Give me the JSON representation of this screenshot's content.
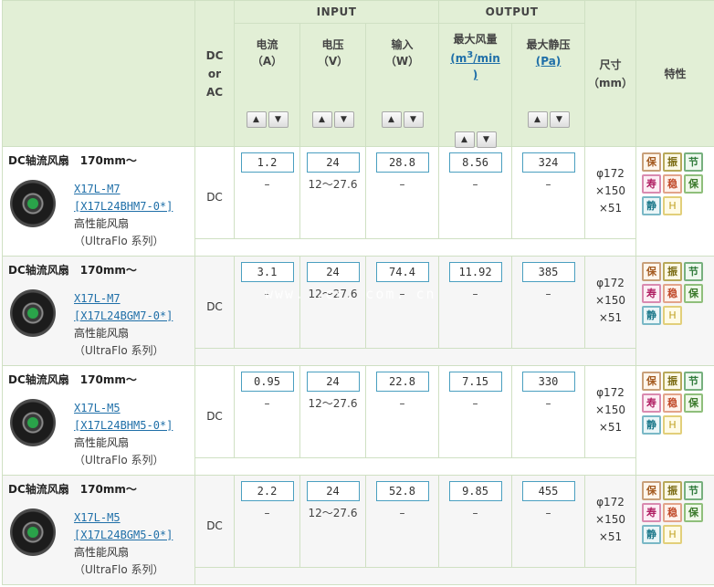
{
  "header": {
    "dc_or_ac": "DC\nor\nAC",
    "input_label": "INPUT",
    "output_label": "OUTPUT",
    "current": "电流\n（A）",
    "voltage": "电压\n（V）",
    "power": "输入\n（W）",
    "airflow_title": "最大风量",
    "airflow_unit_pre": "(m",
    "airflow_unit_sup": "3",
    "airflow_unit_post": "/min\n)",
    "pressure_title": "最大静压",
    "pressure_unit": "(Pa)",
    "size": "尺寸\n（mm）",
    "features": "特性",
    "sort_up": "▲",
    "sort_down": "▼"
  },
  "rows": [
    {
      "title": "DC轴流风扇　170mm～",
      "model": "X17L-M7",
      "code": "[X17L24BHM7-0*]",
      "desc": "高性能风扇",
      "series": "（UltraFlo 系列）",
      "dc": "DC",
      "current": "1.2",
      "current_sub": "–",
      "voltage": "24",
      "voltage_sub": "12～27.6",
      "power": "28.8",
      "power_sub": "–",
      "airflow": "8.56",
      "airflow_sub": "–",
      "pressure": "324",
      "pressure_sub": "–",
      "dim": [
        "φ172",
        "×150",
        "×51"
      ]
    },
    {
      "title": "DC轴流风扇　170mm～",
      "model": "X17L-M7",
      "code": "[X17L24BGM7-0*]",
      "desc": "高性能风扇",
      "series": "（UltraFlo 系列）",
      "dc": "DC",
      "current": "3.1",
      "current_sub": "–",
      "voltage": "24",
      "voltage_sub": "12～27.6",
      "power": "74.4",
      "power_sub": "–",
      "airflow": "11.92",
      "airflow_sub": "–",
      "pressure": "385",
      "pressure_sub": "–",
      "dim": [
        "φ172",
        "×150",
        "×51"
      ]
    },
    {
      "title": "DC轴流风扇　170mm～",
      "model": "X17L-M5",
      "code": "[X17L24BHM5-0*]",
      "desc": "高性能风扇",
      "series": "（UltraFlo 系列）",
      "dc": "DC",
      "current": "0.95",
      "current_sub": "–",
      "voltage": "24",
      "voltage_sub": "12～27.6",
      "power": "22.8",
      "power_sub": "–",
      "airflow": "7.15",
      "airflow_sub": "–",
      "pressure": "330",
      "pressure_sub": "–",
      "dim": [
        "φ172",
        "×150",
        "×51"
      ]
    },
    {
      "title": "DC轴流风扇　170mm～",
      "model": "X17L-M5",
      "code": "[X17L24BGM5-0*]",
      "desc": "高性能风扇",
      "series": "（UltraFlo 系列）",
      "dc": "DC",
      "current": "2.2",
      "current_sub": "–",
      "voltage": "24",
      "voltage_sub": "12～27.6",
      "power": "52.8",
      "power_sub": "–",
      "airflow": "9.85",
      "airflow_sub": "–",
      "pressure": "455",
      "pressure_sub": "–",
      "dim": [
        "φ172",
        "×150",
        "×51"
      ]
    }
  ],
  "badges": [
    "保",
    "振",
    "节",
    "寿",
    "稳",
    "保",
    "静",
    "H"
  ],
  "badge_icons": [
    "feature-warranty-icon",
    "feature-vibration-icon",
    "feature-energy-saving-icon",
    "feature-long-life-icon",
    "feature-stable-icon",
    "feature-protection-icon",
    "feature-quiet-icon",
    "feature-high-icon"
  ],
  "watermark": "www.  .cs. com. cn",
  "colors": {
    "header_bg": "#e2efd6",
    "border": "#cfe0c3",
    "link": "#1f6fa8",
    "value_border": "#4a9fc0"
  }
}
